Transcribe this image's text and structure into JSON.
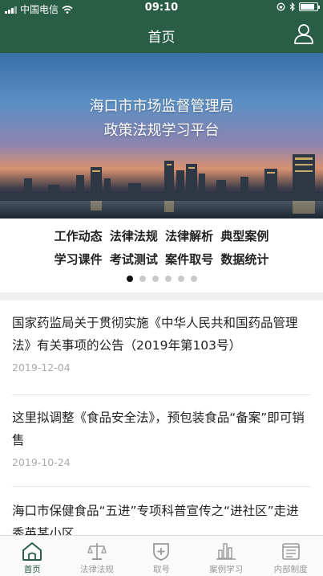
{
  "status_bar": {
    "carrier": "中国电信",
    "time": "09:10",
    "battery_level": 0.85
  },
  "nav": {
    "title": "首页",
    "user_icon": "user-icon"
  },
  "banner": {
    "line1": "海口市市场监督管理局",
    "line2": "政策法规学习平台"
  },
  "menu": {
    "row1": [
      "工作动态",
      "法律法规",
      "法律解析",
      "典型案例"
    ],
    "row2": [
      "学习课件",
      "考试测试",
      "案件取号",
      "数据统计"
    ],
    "pages": 6,
    "active_page": 1
  },
  "news": [
    {
      "title": "国家药监局关于贯彻实施《中华人民共和国药品管理法》有关事项的公告（2019年第103号）",
      "date": "2019-12-04"
    },
    {
      "title": "这里拟调整《食品安全法》，预包装食品“备案”即可销售",
      "date": "2019-10-24"
    },
    {
      "title": "海口市保健食品“五进”专项科普宣传之“进社区”走进秀英某小区",
      "date": ""
    }
  ],
  "tabs": [
    {
      "label": "首页",
      "icon": "home-icon",
      "active": true
    },
    {
      "label": "法律法规",
      "icon": "scales-icon",
      "active": false
    },
    {
      "label": "取号",
      "icon": "shield-plus-icon",
      "active": false
    },
    {
      "label": "案例学习",
      "icon": "bar-chart-icon",
      "active": false
    },
    {
      "label": "内部制度",
      "icon": "document-icon",
      "active": false
    }
  ],
  "colors": {
    "brand": "#2a5d45",
    "inactive": "#999999"
  }
}
